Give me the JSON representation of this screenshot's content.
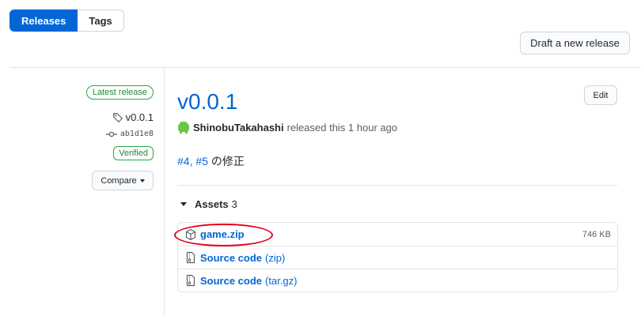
{
  "tabs": [
    {
      "label": "Releases",
      "active": true
    },
    {
      "label": "Tags",
      "active": false
    }
  ],
  "actions": {
    "draft_label": "Draft a new release"
  },
  "sidebar": {
    "latest_label": "Latest release",
    "tag": "v0.0.1",
    "commit": "ab1d1e8",
    "verified_label": "Verified",
    "compare_label": "Compare"
  },
  "release": {
    "title": "v0.0.1",
    "edit_label": "Edit",
    "author": "ShinobuTakahashi",
    "released_text": "released this 1 hour ago",
    "body": {
      "issue1": "#4",
      "sep": ", ",
      "issue2": "#5",
      "rest": " の修正"
    }
  },
  "assets": {
    "title": "Assets",
    "count": "3",
    "items": [
      {
        "name": "game.zip",
        "suffix": "",
        "size": "746 KB",
        "icon": "package-icon"
      },
      {
        "name": "Source code",
        "suffix": "(zip)",
        "size": "",
        "icon": "file-zip-icon"
      },
      {
        "name": "Source code",
        "suffix": "(tar.gz)",
        "size": "",
        "icon": "file-zip-icon"
      }
    ]
  },
  "colors": {
    "accent": "#0366d6",
    "success": "#28a745",
    "annotation": "#e3001b"
  }
}
